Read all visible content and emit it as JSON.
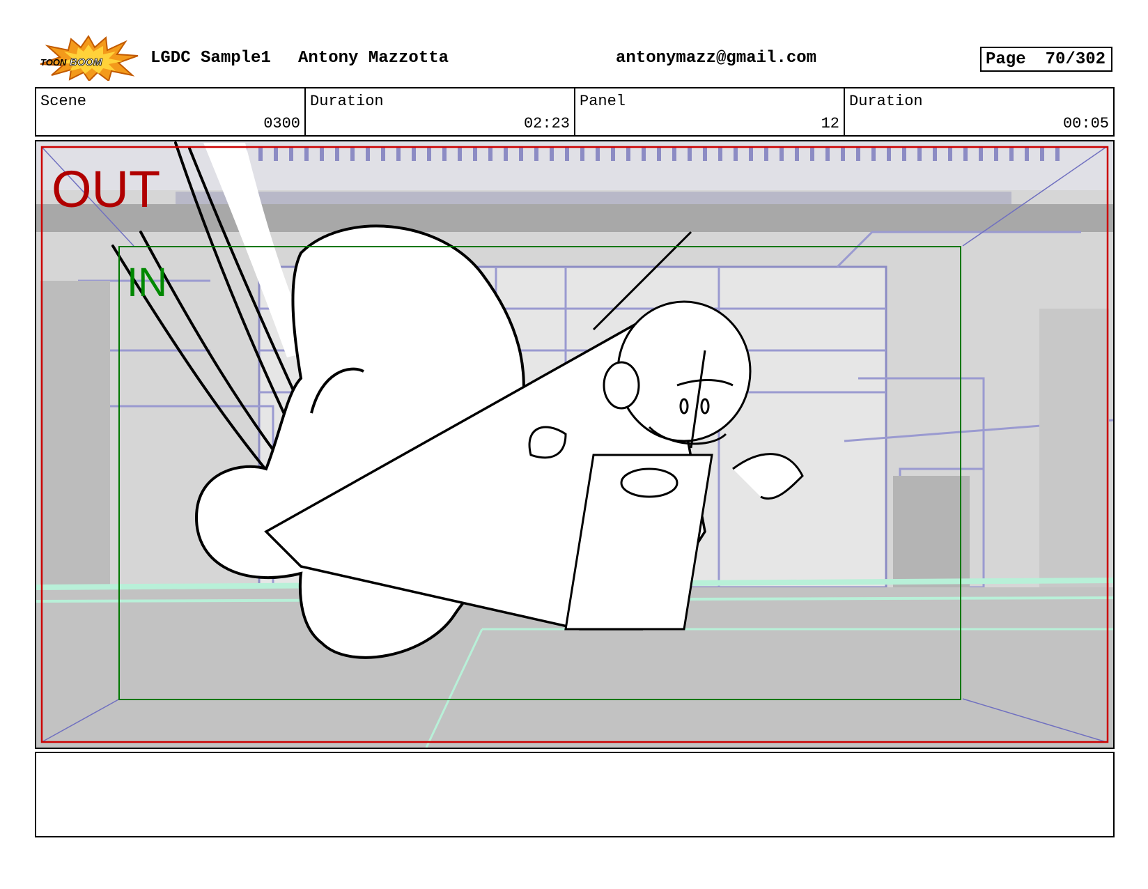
{
  "header": {
    "logo_text": "TOON BOOM",
    "project": "LGDC Sample1",
    "author": "Antony Mazzotta",
    "email": "antonymazz@gmail.com",
    "page_label": "Page",
    "page_number": "70/302"
  },
  "info": {
    "scene_label": "Scene",
    "scene_value": "0300",
    "scene_duration_label": "Duration",
    "scene_duration_value": "02:23",
    "panel_label": "Panel",
    "panel_value": "12",
    "panel_duration_label": "Duration",
    "panel_duration_value": "00:05"
  },
  "frame": {
    "out_label": "OUT",
    "in_label": "IN",
    "out_color": "#b00000",
    "in_color": "#008800"
  },
  "notes": {
    "text": ""
  }
}
